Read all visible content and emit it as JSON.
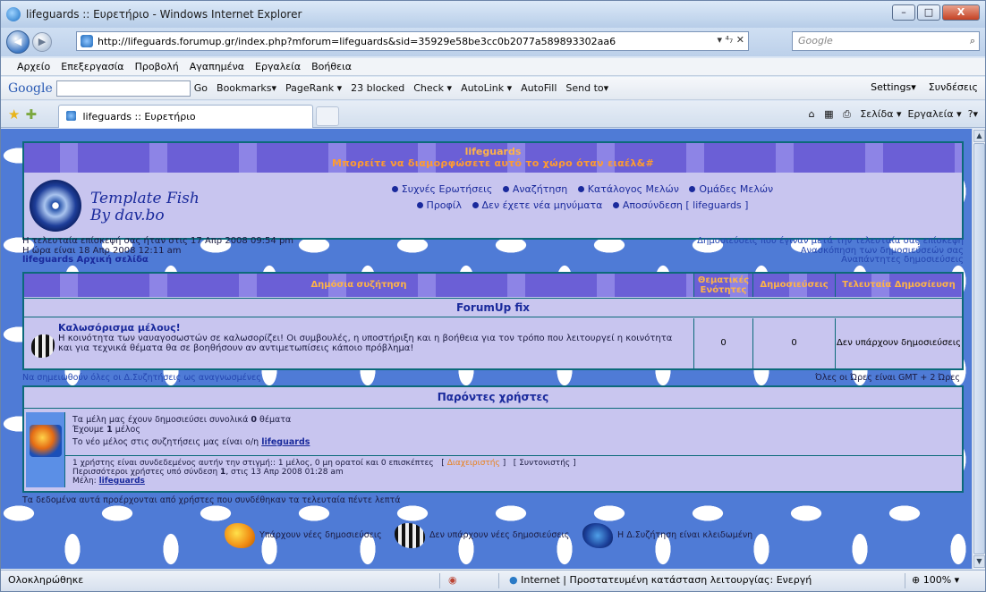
{
  "window": {
    "title": "lifeguards :: Ευρετήριο - Windows Internet Explorer",
    "min": "–",
    "max": "□",
    "close": "X"
  },
  "address": {
    "url": "http://lifeguards.forumup.gr/index.php?mforum=lifeguards&sid=35929e58be3cc0b2077a589893302aa6",
    "controls": "▾  ⁴₇  ✕",
    "search_placeholder": "Google",
    "search_icon": "⌕"
  },
  "nav": {
    "back_icon": "◀",
    "forward_icon": "▶"
  },
  "menu": [
    "Αρχείο",
    "Επεξεργασία",
    "Προβολή",
    "Αγαπημένα",
    "Εργαλεία",
    "Βοήθεια"
  ],
  "google_toolbar": {
    "logo": "Google",
    "items": [
      "Go",
      "Bookmarks▾",
      "PageRank ▾",
      "23 blocked",
      "Check ▾",
      "AutoLink ▾",
      "AutoFill",
      "Send to▾"
    ],
    "settings": "Settings▾",
    "connect": "Συνδέσεις"
  },
  "tab": {
    "title": "lifeguards :: Ευρετήριο"
  },
  "command_bar": {
    "page": "Σελίδα ▾",
    "tools": "Εργαλεία ▾",
    "help": "?▾"
  },
  "banner": {
    "site": "lifeguards",
    "subtitle": "Μπορείτε να διαμορφώσετε αυτό το χώρο όταν ειαέλ&#"
  },
  "logo": {
    "line1": "Template Fish",
    "line2": "By dav.bo"
  },
  "navlinks": {
    "row1": [
      "Συχνές Ερωτήσεις",
      "Αναζήτηση",
      "Κατάλογος Μελών",
      "Ομάδες Μελών"
    ],
    "row2": [
      "Προφίλ",
      "Δεν έχετε νέα μηνύματα",
      "Αποσύνδεση [ lifeguards ]"
    ]
  },
  "info": {
    "last_visit": "Η τελευταία επίσκεψή σας ήταν στις 17 Απρ 2008 09:54 pm",
    "now": "Η ώρα είναι 18 Απρ 2008 12:11 am",
    "home": "lifeguards Αρχική σελίδα",
    "r1": "Δημοσιεύσεις που έγιναν μετά την τελευταία σας επίσκεψη",
    "r2": "Ανασκόπηση των δημοσιεύσεών σας",
    "r3": "Αναπάντητες δημοσιεύσεις"
  },
  "forum_table": {
    "headers": [
      "Δημόσια συζήτηση",
      "Θεματικές Ενότητες",
      "Δημοσιεύσεις",
      "Τελευταία Δημοσίευση"
    ],
    "category": "ForumUp fix",
    "forum_title": "Καλωσόρισμα μέλους!",
    "forum_desc": "Η κοινότητα των ναυαγοσωστών σε καλωσορίζει! Οι συμβουλές, η υποστήριξη και η βοήθεια για τον τρόπο που λειτουργεί η κοινότητα και για τεχνικά θέματα θα σε βοηθήσουν αν αντιμετωπίσεις κάποιο πρόβλημα!",
    "topics": "0",
    "posts": "0",
    "last_post": "Δεν υπάρχουν δημοσιεύσεις"
  },
  "mark_read": "Να σημειωθούν όλες οι Δ.Συζητήσεις ως αναγνωσμένες",
  "timezone": "Όλες οι Ώρες είναι GMT + 2 Ώρες",
  "users": {
    "header": "Παρόντες χρήστες",
    "total_pre": "Τα μέλη μας έχουν δημοσιεύσει συνολικά ",
    "total_num": "0",
    "total_post": " θέματα",
    "members_pre": "Έχουμε ",
    "members_num": "1",
    "members_post": " μέλος",
    "newest_pre": "Το νέο μέλος στις συζητήσεις μας είναι ο/η ",
    "newest_name": "lifeguards",
    "online": "1 χρήστης είναι συνδεδεμένος αυτήν την στιγμή:: 1 μέλος, 0 μη ορατοί και 0 επισκέπτες",
    "admin_open": "[",
    "admin": "Διαχειριστής",
    "admin_close": "]",
    "mod_open": "[",
    "mod": "Συντονιστής",
    "mod_close": "]",
    "record_pre": "Περισσότεροι χρήστες υπό σύνδεση ",
    "record_num": "1",
    "record_post": ", στις 13 Απρ 2008 01:28 am",
    "members_label": "Μέλη: ",
    "members_name": "lifeguards"
  },
  "footer_note": "Τα δεδομένα αυτά προέρχονται από χρήστες που συνδέθηκαν τα τελευταία πέντε λεπτά",
  "legend": [
    "Υπάρχουν νέες δημοσιεύσεις",
    "Δεν υπάρχουν νέες δημοσιεύσεις",
    "Η Δ.Συζήτηση είναι κλειδωμένη"
  ],
  "status": {
    "left": "Ολοκληρώθηκε",
    "mid": "Internet | Προστατευμένη κατάσταση λειτουργίας: Ενεργή",
    "zoom": "100%",
    "zoom_caret": "▾"
  },
  "colors": {
    "frame": "#0c6a7a",
    "banner": "#6b5fd6",
    "panel": "#c8c5ef",
    "link": "#1a2a9c",
    "accent": "#e9801a"
  }
}
